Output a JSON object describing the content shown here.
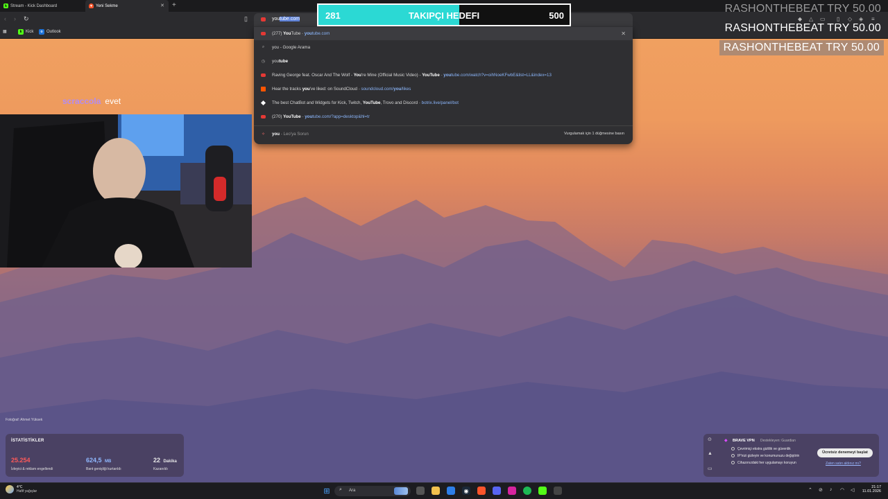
{
  "tabs": [
    {
      "label": "Stream - Kick Dashboard"
    },
    {
      "label": "Yeni Sekme"
    }
  ],
  "bookmarks": [
    {
      "label": "Kick"
    },
    {
      "label": "Outlook"
    }
  ],
  "omnibox": {
    "typed": "you",
    "autocomplete": "tube.com"
  },
  "suggestions": [
    {
      "prefix": "(277) ",
      "bold": "You",
      "rest": "Tube",
      "sep": " - ",
      "url_bold": "you",
      "url": "tube.com"
    },
    {
      "text": "you - Google Arama"
    },
    {
      "bold_a": "you",
      "text_b": "tube"
    },
    {
      "text_a": "Raving George feat. Oscar And The Wolf - ",
      "bold_a": "You",
      "text_b": "'re Mine (Official Music Video) - ",
      "bold_b": "YouTube",
      "sep": " - ",
      "url_bold": "you",
      "url": "tube.com/watch?v=oihNoeKFwbE&list=LL&index=13"
    },
    {
      "text_a": "Hear the tracks ",
      "bold_a": "you",
      "text_b": "'ve liked: on SoundCloud",
      "sep": " - ",
      "url": "soundcloud.com/",
      "url_bold": "you",
      "url_b": "/likes"
    },
    {
      "text_a": "The best ChatBot and Widgets for Kick, Twitch, ",
      "bold_a": "YouTube",
      "text_b": ", Trovo and Discord",
      "sep": " - ",
      "url": "botrix.live/panel/bot"
    },
    {
      "prefix": "(270) ",
      "bold": "YouTube",
      "sep": " - ",
      "url_bold": "you",
      "url": "tube.com/?app=desktop&hl=tr"
    },
    {
      "bold_a": "you",
      "sep": " - ",
      "text_b": "Leo'ya Sorun",
      "hint": "Vurgulamak için 1 düğmesine basın"
    }
  ],
  "goal": {
    "current": "281",
    "label": "TAKIPÇI HEDEFI",
    "target": "500",
    "progress": 0.562,
    "fill_color": "#2bd9d4"
  },
  "donations": [
    {
      "text": "RASHONTHEBEAT  TRY 50.00"
    },
    {
      "text": "RASHONTHEBEAT  TRY 50.00"
    },
    {
      "text": "RASHONTHEBEAT  TRY 50.00"
    }
  ],
  "chat": {
    "user": "scraccola",
    "message": "evet"
  },
  "photo_credit": "Fotoğraf: Ahmet Yüksek",
  "stats": {
    "title": "İSTATİSTİKLER",
    "items": [
      {
        "value": "25.254",
        "unit": "",
        "desc": "İzleyici & reklam engellendi",
        "color": "#ff5a5a"
      },
      {
        "value": "624,5",
        "unit": "MB",
        "desc": "Bant genişliği kurtarıldı",
        "color": "#8fb8ff"
      },
      {
        "value": "22",
        "unit": "Dakika",
        "desc": "Kazanıldı",
        "color": "#ffffff"
      }
    ]
  },
  "vpn": {
    "title": "BRAVE VPN",
    "sponsor": "Destekleyen: Guardian",
    "lines": [
      "Çevrimiçi ekstra gizlilik ve güvenlik",
      "IP'nizi gizleyin ve konumunuzu değiştirin",
      "Cihazınızdaki her uygulamayı koruyun"
    ],
    "button": "Ücretsiz denemeyi başlat",
    "link": "Zaten satın aldınız mı?"
  },
  "taskbar": {
    "weather_temp": "4°C",
    "weather_desc": "Hafif yağışlar",
    "search_label": "Ara",
    "time": "21:17",
    "date": "11.01.2026"
  }
}
